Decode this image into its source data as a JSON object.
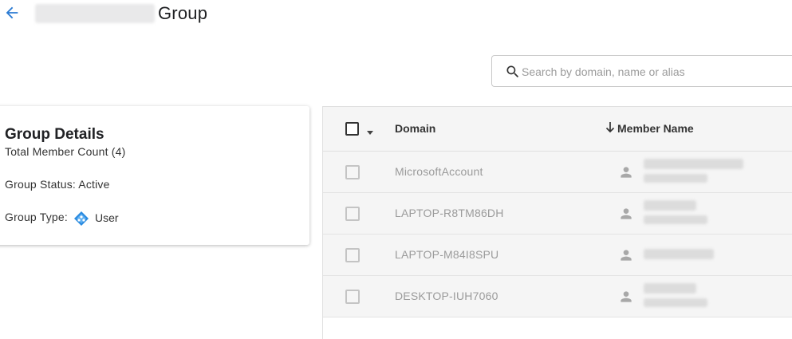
{
  "header": {
    "title": "Group",
    "back_icon": "arrow-left-icon"
  },
  "search": {
    "placeholder": "Search by domain, name or alias",
    "value": ""
  },
  "group_details": {
    "title": "Group Details",
    "member_count_text": "Total Member Count (4)",
    "status_text": "Group Status: Active",
    "type_label": "Group Type:",
    "type_value": "User",
    "type_icon": "user-group-diamond-icon"
  },
  "table": {
    "columns": {
      "domain": "Domain",
      "member_name": "Member Name"
    },
    "sort": {
      "column": "member_name",
      "direction": "descending"
    },
    "rows": [
      {
        "domain": "MicrosoftAccount"
      },
      {
        "domain": "LAPTOP-R8TM86DH"
      },
      {
        "domain": "LAPTOP-M84I8SPU"
      },
      {
        "domain": "DESKTOP-IUH7060"
      }
    ]
  },
  "colors": {
    "accent": "#2b7bd3",
    "row_background": "#f5f5f5",
    "muted_text": "#9b9b9b"
  }
}
